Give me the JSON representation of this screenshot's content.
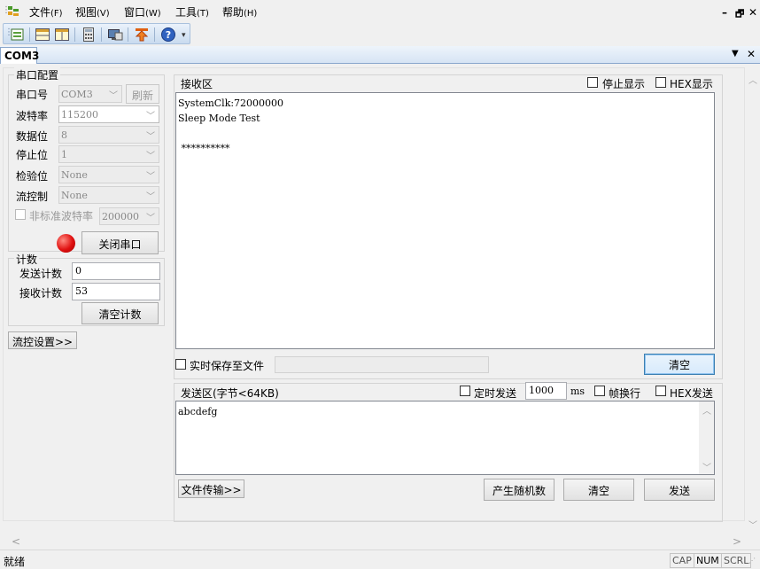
{
  "menubar": {
    "items": [
      {
        "label": "文件",
        "accel": "(F)"
      },
      {
        "label": "视图",
        "accel": "(V)"
      },
      {
        "label": "窗口",
        "accel": "(W)"
      },
      {
        "label": "工具",
        "accel": "(T)"
      },
      {
        "label": "帮助",
        "accel": "(H)"
      }
    ],
    "window_controls": [
      "–",
      "🗗",
      "✕"
    ]
  },
  "toolbar": {
    "icons": [
      "new-port-icon",
      "split-horizontal-icon",
      "split-vertical-icon",
      "calculator-icon",
      "monitor-icon",
      "upload-icon",
      "help-icon"
    ]
  },
  "tabs": [
    {
      "label": "COM3"
    }
  ],
  "tab_controls": [
    "▼",
    "✕"
  ],
  "serial_config": {
    "title": "串口配置",
    "port_label": "串口号",
    "port_value": "COM3",
    "refresh_label": "刷新",
    "baud_label": "波特率",
    "baud_value": "115200",
    "databits_label": "数据位",
    "databits_value": "8",
    "stopbits_label": "停止位",
    "stopbits_value": "1",
    "parity_label": "检验位",
    "parity_value": "None",
    "flow_label": "流控制",
    "flow_value": "None",
    "nonstd_label": "非标准波特率",
    "nonstd_value": "200000",
    "close_port_label": "关闭串口",
    "indicator_color": "#e01010"
  },
  "counter": {
    "title": "计数",
    "send_label": "发送计数",
    "send_value": "0",
    "recv_label": "接收计数",
    "recv_value": "53",
    "clear_label": "清空计数"
  },
  "flow_settings_label": "流控设置>>",
  "receive": {
    "title": "接收区",
    "stop_display_label": "停止显示",
    "hex_display_label": "HEX显示",
    "content": "SystemClk:72000000\nSleep Mode Test\n\n **********",
    "save_file_label": "实时保存至文件",
    "clear_label": "清空"
  },
  "send": {
    "title": "发送区(字节<64KB)",
    "timed_label": "定时发送",
    "interval_value": "1000",
    "interval_unit": "ms",
    "newline_label": "帧换行",
    "hex_send_label": "HEX发送",
    "content": "abcdefg",
    "file_transfer_label": "文件传输>>",
    "random_label": "产生随机数",
    "clear_label": "清空",
    "send_label": "发送"
  },
  "statusbar": {
    "status": "就绪",
    "cap": "CAP",
    "num": "NUM",
    "scrl": "SCRL"
  }
}
